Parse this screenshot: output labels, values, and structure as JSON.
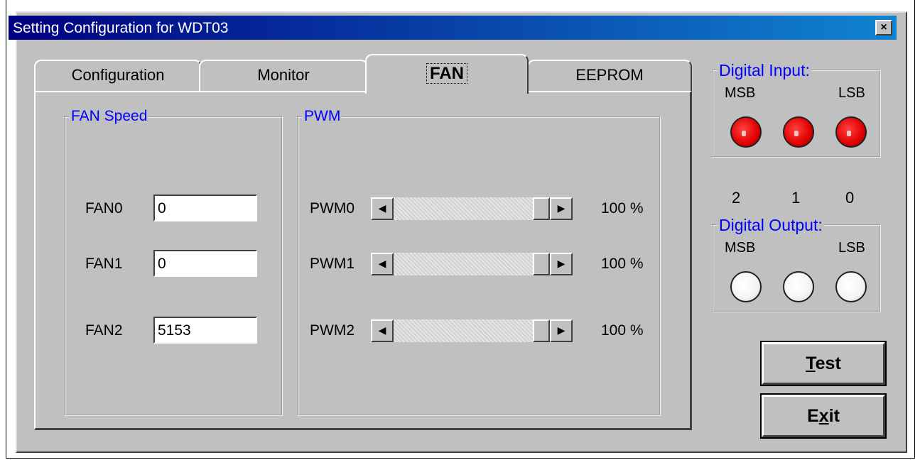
{
  "window": {
    "title": "Setting Configuration for WDT03",
    "close_label": "×"
  },
  "tabs": [
    {
      "label": "Configuration"
    },
    {
      "label": "Monitor"
    },
    {
      "label": "FAN",
      "active": true
    },
    {
      "label": "EEPROM"
    }
  ],
  "fan_speed": {
    "title": "FAN Speed",
    "rows": [
      {
        "label": "FAN0",
        "value": "0"
      },
      {
        "label": "FAN1",
        "value": "0"
      },
      {
        "label": "FAN2",
        "value": "5153"
      }
    ]
  },
  "pwm": {
    "title": "PWM",
    "rows": [
      {
        "label": "PWM0",
        "value_text": "100 %",
        "level": 1.0
      },
      {
        "label": "PWM1",
        "value_text": "100 %",
        "level": 1.0
      },
      {
        "label": "PWM2",
        "value_text": "100 %",
        "level": 1.0
      }
    ]
  },
  "digital_input": {
    "title": "Digital Input:",
    "msb": "MSB",
    "lsb": "LSB",
    "states": [
      "on",
      "on",
      "on"
    ],
    "on_color": "#e00000"
  },
  "bit_numbers": [
    "2",
    "1",
    "0"
  ],
  "digital_output": {
    "title": "Digital Output:",
    "msb": "MSB",
    "lsb": "LSB",
    "states": [
      "off",
      "off",
      "off"
    ]
  },
  "buttons": {
    "test_pre": "",
    "test_accel": "T",
    "test_post": "est",
    "exit_pre": "E",
    "exit_accel": "x",
    "exit_post": "it"
  },
  "colors": {
    "title_bar_start": "#000080",
    "title_bar_end": "#1084d0",
    "group_title": "#0000ff",
    "dialog_bg": "#c0c0c0"
  }
}
